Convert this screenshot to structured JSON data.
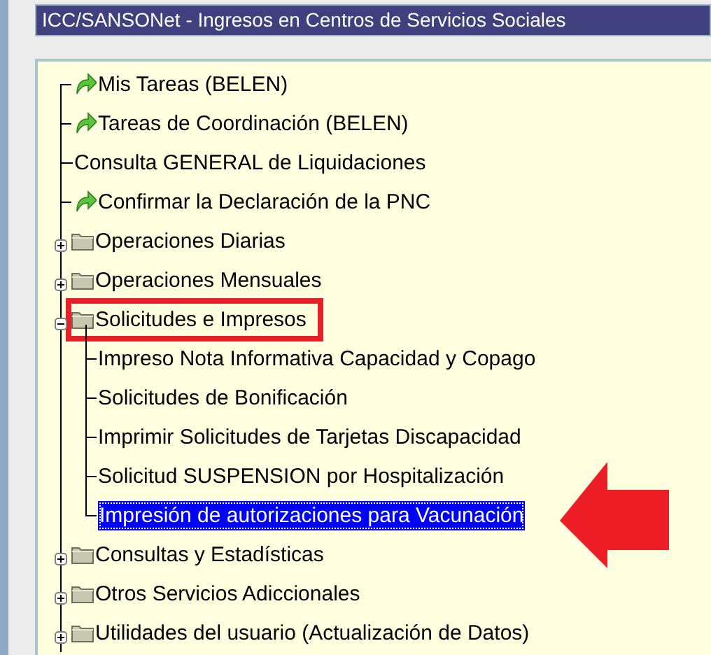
{
  "window": {
    "title": "ICC/SANSONet - Ingresos en Centros de Servicios Sociales"
  },
  "tree": [
    {
      "kind": "task",
      "label": "Mis Tareas (BELEN)"
    },
    {
      "kind": "task",
      "label": "Tareas de Coordinación (BELEN)"
    },
    {
      "kind": "link",
      "label": "Consulta GENERAL de Liquidaciones"
    },
    {
      "kind": "task",
      "label": "Confirmar la Declaración de la PNC"
    },
    {
      "kind": "folder",
      "label": "Operaciones Diarias",
      "expanded": false,
      "highlighted": false
    },
    {
      "kind": "folder",
      "label": "Operaciones Mensuales",
      "expanded": false,
      "highlighted": false
    },
    {
      "kind": "folder",
      "label": "Solicitudes e Impresos",
      "expanded": true,
      "highlighted": true,
      "children": [
        {
          "label": "Impreso Nota Informativa Capacidad y Copago",
          "selected": false,
          "pointed": false
        },
        {
          "label": "Solicitudes de Bonificación",
          "selected": false,
          "pointed": false
        },
        {
          "label": "Imprimir Solicitudes de Tarjetas Discapacidad",
          "selected": false,
          "pointed": false
        },
        {
          "label": "Solicitud SUSPENSION por Hospitalización",
          "selected": false,
          "pointed": false
        },
        {
          "label": "Impresión de autorizaciones para Vacunación",
          "selected": true,
          "pointed": true
        }
      ]
    },
    {
      "kind": "folder",
      "label": "Consultas y Estadísticas",
      "expanded": false,
      "highlighted": false
    },
    {
      "kind": "folder",
      "label": "Otros Servicios Adiccionales",
      "expanded": false,
      "highlighted": false
    },
    {
      "kind": "folder",
      "label": "Utilidades del usuario (Actualización de Datos)",
      "expanded": false,
      "highlighted": false
    }
  ]
}
